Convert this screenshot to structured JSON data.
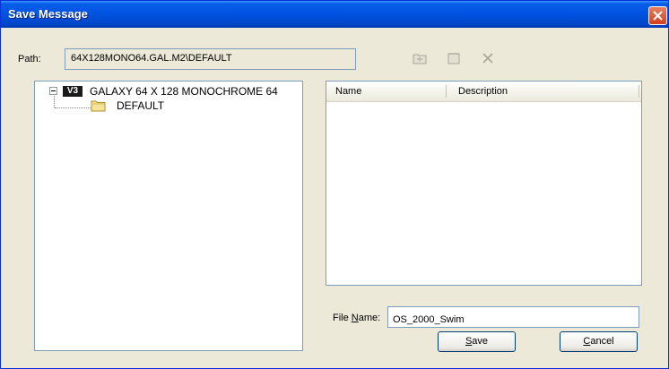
{
  "window": {
    "title": "Save Message",
    "close_icon": "close-icon"
  },
  "path": {
    "label": "Path:",
    "value": "64X128MONO64.GAL.M2\\DEFAULT"
  },
  "toolbar": {
    "icons": [
      "new-folder-icon",
      "folder-properties-icon",
      "delete-icon"
    ]
  },
  "tree": {
    "root": {
      "badge": "V3",
      "label": "GALAXY 64 X 128 MONOCHROME 64",
      "expanded": true
    },
    "children": [
      {
        "label": "DEFAULT",
        "icon": "folder-icon"
      }
    ]
  },
  "list": {
    "columns": [
      "Name",
      "Description"
    ],
    "rows": []
  },
  "file_name": {
    "label_prefix": "File ",
    "label_accel": "N",
    "label_suffix": "ame:",
    "value": "OS_2000_Swim"
  },
  "buttons": {
    "save": {
      "accel": "S",
      "rest": "ave"
    },
    "cancel": {
      "accel": "C",
      "rest": "ancel"
    }
  },
  "colors": {
    "title_bar": "#0054e3",
    "dialog_bg": "#ece9d8",
    "close_button": "#d0401e"
  }
}
